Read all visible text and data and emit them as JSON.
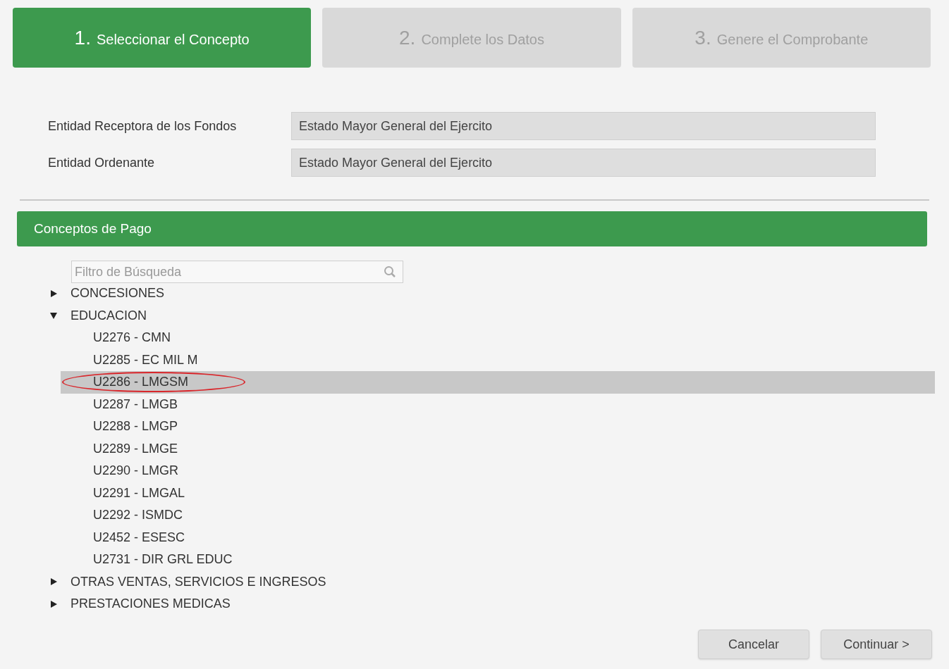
{
  "steps": [
    {
      "number": "1.",
      "label": "Seleccionar el Concepto",
      "selected": true
    },
    {
      "number": "2.",
      "label": "Complete los Datos",
      "selected": false
    },
    {
      "number": "3.",
      "label": "Genere el Comprobante",
      "selected": false
    }
  ],
  "fields": [
    {
      "label": "Entidad Receptora de los Fondos",
      "value": "Estado Mayor General del Ejercito"
    },
    {
      "label": "Entidad Ordenante",
      "value": "Estado Mayor General del Ejercito"
    }
  ],
  "panel": {
    "title": "Conceptos de Pago",
    "search": {
      "placeholder": "Filtro de Búsqueda"
    },
    "tree": [
      {
        "label": "CONCESIONES",
        "expanded": false,
        "selected": false
      },
      {
        "label": "EDUCACION",
        "expanded": true,
        "selected": false,
        "children": [
          {
            "label": "U2276 - CMN",
            "selected": false,
            "circled": false
          },
          {
            "label": "U2285 - EC MIL M",
            "selected": false,
            "circled": false
          },
          {
            "label": "U2286 - LMGSM",
            "selected": true,
            "circled": true
          },
          {
            "label": "U2287 - LMGB",
            "selected": false,
            "circled": false
          },
          {
            "label": "U2288 - LMGP",
            "selected": false,
            "circled": false
          },
          {
            "label": "U2289 - LMGE",
            "selected": false,
            "circled": false
          },
          {
            "label": "U2290 - LMGR",
            "selected": false,
            "circled": false
          },
          {
            "label": "U2291 - LMGAL",
            "selected": false,
            "circled": false
          },
          {
            "label": "U2292 - ISMDC",
            "selected": false,
            "circled": false
          },
          {
            "label": "U2452 - ESESC",
            "selected": false,
            "circled": false
          },
          {
            "label": "U2731 - DIR GRL EDUC",
            "selected": false,
            "circled": false
          }
        ]
      },
      {
        "label": "OTRAS VENTAS, SERVICIOS E INGRESOS",
        "expanded": false,
        "selected": false
      },
      {
        "label": "PRESTACIONES MEDICAS",
        "expanded": false,
        "selected": false
      }
    ]
  },
  "buttons": [
    "Cancelar",
    "Continuar >"
  ]
}
